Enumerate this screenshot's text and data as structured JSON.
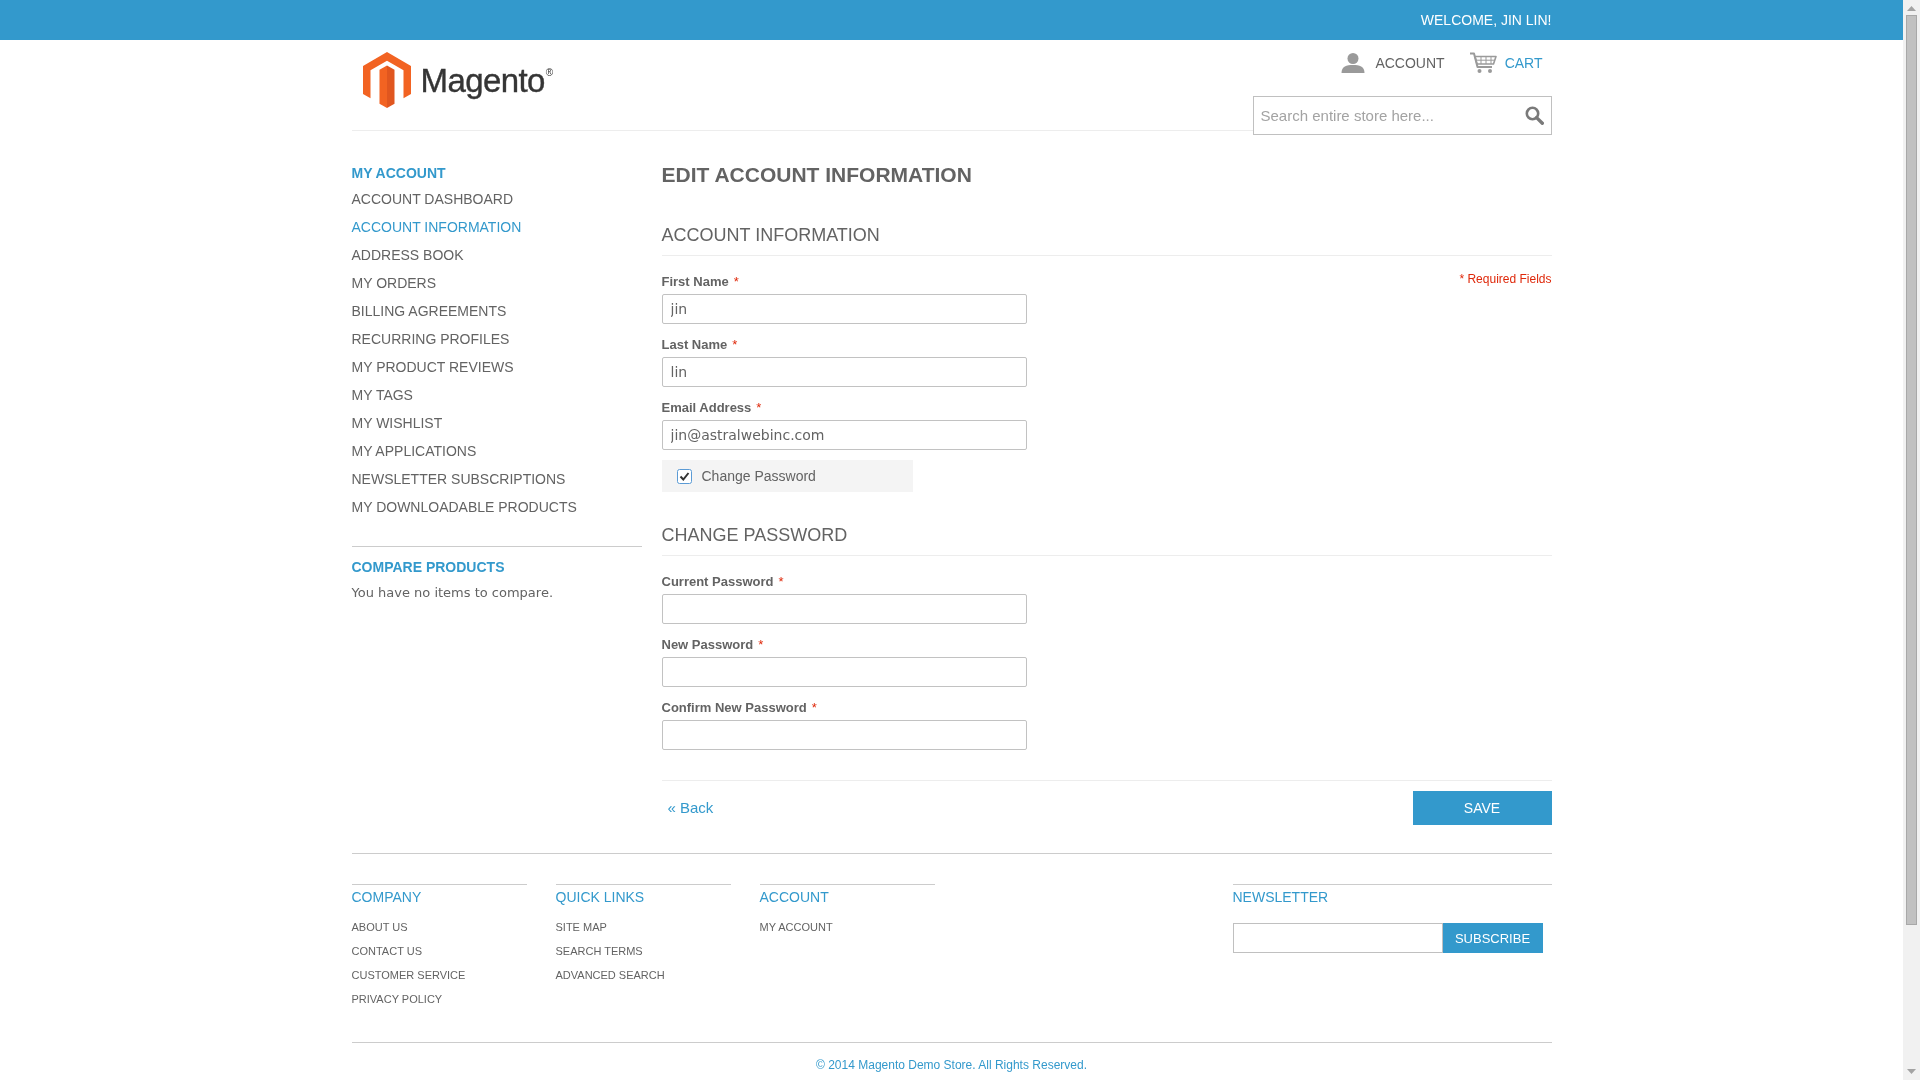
{
  "top_bar": {
    "welcome": "WELCOME, JIN LIN!"
  },
  "header": {
    "logo": "Magento$^{®}$",
    "links": [
      {
        "kind": "account",
        "label": "ACCOUNT",
        "highlighted": false
      },
      {
        "kind": "cart",
        "label": "CART",
        "highlighted": true
      }
    ],
    "search": {
      "placeholder": "Search entire store here..."
    }
  },
  "sidebar": {
    "title": "MY ACCOUNT",
    "items": [
      {
        "label": "ACCOUNT DASHBOARD",
        "selected": false
      },
      {
        "label": "ACCOUNT INFORMATION",
        "selected": true
      },
      {
        "label": "ADDRESS BOOK",
        "selected": false
      },
      {
        "label": "MY ORDERS",
        "selected": false
      },
      {
        "label": "BILLING AGREEMENTS",
        "selected": false
      },
      {
        "label": "RECURRING PROFILES",
        "selected": false
      },
      {
        "label": "MY PRODUCT REVIEWS",
        "selected": false
      },
      {
        "label": "MY TAGS",
        "selected": false
      },
      {
        "label": "MY WISHLIST",
        "selected": false
      },
      {
        "label": "MY APPLICATIONS",
        "selected": false
      },
      {
        "label": "NEWSLETTER SUBSCRIPTIONS",
        "selected": false
      },
      {
        "label": "MY DOWNLOADABLE PRODUCTS",
        "selected": false
      }
    ],
    "compare": {
      "title": "COMPARE PRODUCTS",
      "message": "You have no items to compare."
    }
  },
  "main": {
    "title": "EDIT ACCOUNT INFORMATION",
    "sections": [
      {
        "title": "ACCOUNT INFORMATION",
        "required_note": "* Required Fields",
        "fields": [
          {
            "label": "First Name",
            "required_mark": "*",
            "value": "jin"
          },
          {
            "label": "Last Name",
            "required_mark": "*",
            "value": "lin"
          },
          {
            "label": "Email Address",
            "required_mark": "*",
            "value": "jin@astralwebinc.com"
          }
        ],
        "toggle": {
          "label": "Change Password",
          "checked": true
        }
      },
      {
        "title": "CHANGE PASSWORD",
        "fields": [
          {
            "label": "Current Password",
            "required_mark": "*"
          },
          {
            "label": "New Password",
            "required_mark": "*"
          },
          {
            "label": "Confirm New Password",
            "required_mark": "*"
          }
        ]
      }
    ],
    "back_link": "« Back",
    "save_button": "SAVE"
  },
  "footer": {
    "columns": [
      {
        "title": "COMPANY",
        "links": [
          "ABOUT US",
          "CONTACT US",
          "CUSTOMER SERVICE",
          "PRIVACY POLICY"
        ]
      },
      {
        "title": "QUICK LINKS",
        "links": [
          "SITE MAP",
          "SEARCH TERMS",
          "ADVANCED SEARCH"
        ]
      },
      {
        "title": "ACCOUNT",
        "links": [
          "MY ACCOUNT"
        ]
      }
    ],
    "newsletter": {
      "title": "NEWSLETTER",
      "button": "SUBSCRIBE"
    },
    "copyright": "© 2014 Magento Demo Store. All Rights Reserved."
  }
}
